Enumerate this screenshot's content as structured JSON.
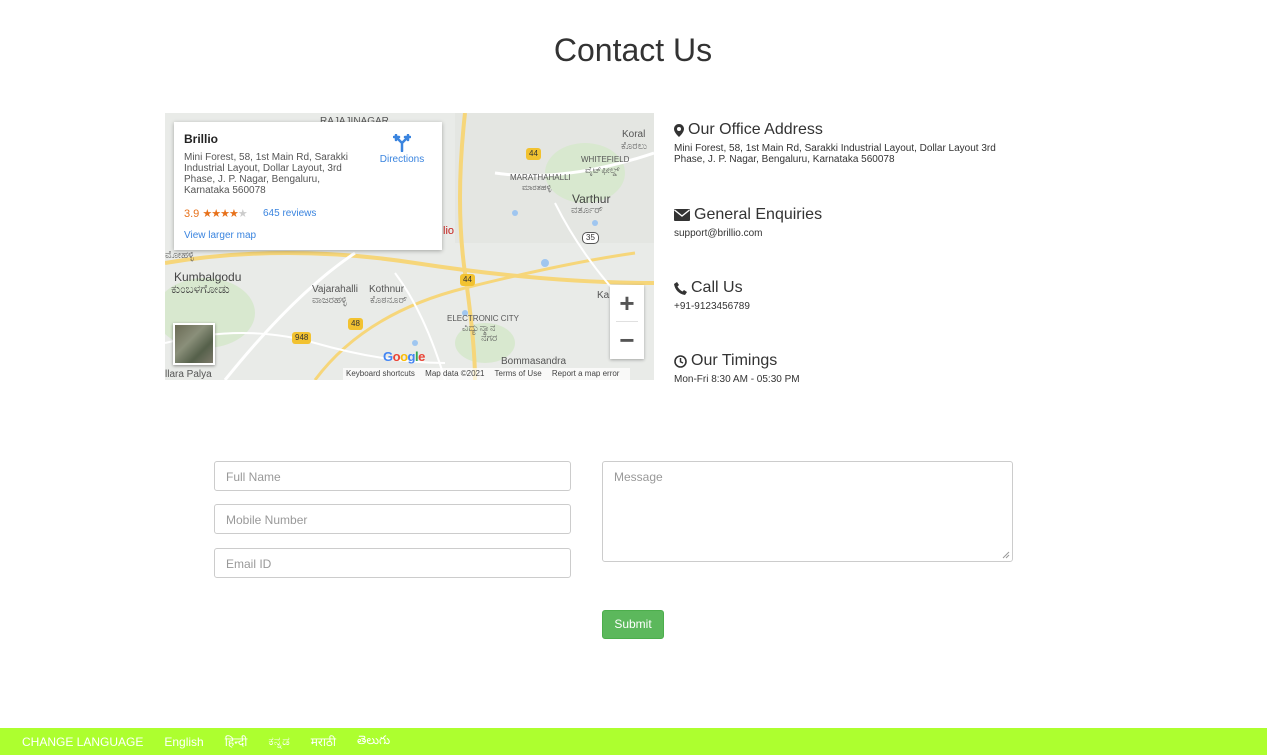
{
  "page": {
    "title": "Contact Us"
  },
  "map": {
    "place_name": "Brillio",
    "place_address": "Mini Forest, 58, 1st Main Rd, Sarakki Industrial Layout, Dollar Layout, 3rd Phase, J. P. Nagar, Bengaluru, Karnataka 560078",
    "rating": "3.9",
    "stars": 3.9,
    "reviews": "645 reviews",
    "directions": "Directions",
    "larger_map": "View larger map",
    "zoom_in": "+",
    "zoom_out": "−",
    "google": "Google",
    "keyboard_shortcuts": "Keyboard shortcuts",
    "map_data": "Map data ©2021",
    "terms": "Terms of Use",
    "report": "Report a map error",
    "labels": {
      "rajajinagar": "RAJAJINAGAR",
      "koral": "Koral",
      "koral_kn": "ಕೊರಲು",
      "whitefield": "WHITEFIELD",
      "whitefield_kn": "ವೈಟ್‌ಫೀಲ್ಡ್",
      "marathahalli": "MARATHAHALLI",
      "marathahalli_kn": "ಮಾರತಹಳ್ಳಿ",
      "varthur": "Varthur",
      "varthur_kn": "ವರ್ತೂರ್",
      "kumbalgodu": "Kumbalgodu",
      "kumbalgodu_kn": "ಕುಂಬಳಗೋಡು",
      "vajarahalli": "Vajarahalli",
      "vajarahalli_kn": "ವಾಜರಹಳ್ಳಿ",
      "kothnur": "Kothnur",
      "kothnur_kn": "ಕೊಠನೂರ್",
      "electronic_city": "ELECTRONIC CITY",
      "electronic_city_kn1": "ವಿದ್ಯುನ್ಮಾನ",
      "electronic_city_kn2": "ನಗರ",
      "bommasandra": "Bommasandra",
      "pallya": "llara Palya",
      "ka": "Ka",
      "lio": "lio",
      "halli_kn": "ಮೋಹಳ್ಳಿ",
      "r44a": "44",
      "r44b": "44",
      "r48": "48",
      "r948": "948",
      "r35": "35"
    }
  },
  "contact": {
    "address_heading": "Our Office Address",
    "address_text": "Mini Forest, 58, 1st Main Rd, Sarakki Industrial Layout, Dollar Layout 3rd Phase, J. P. Nagar, Bengaluru, Karnataka 560078",
    "enquiries_heading": "General Enquiries",
    "enquiries_text": "support@brillio.com",
    "call_heading": "Call Us",
    "call_text": "+91-9123456789",
    "timings_heading": "Our Timings",
    "timings_text": "Mon-Fri 8:30 AM - 05:30 PM"
  },
  "form": {
    "full_name_placeholder": "Full Name",
    "mobile_placeholder": "Mobile Number",
    "email_placeholder": "Email ID",
    "message_placeholder": "Message",
    "submit_label": "Submit"
  },
  "footer": {
    "change_language": "CHANGE LANGUAGE",
    "languages": [
      "English",
      "हिन्दी",
      "ಕನ್ನಡ",
      "मराठी",
      "తెలుగు"
    ]
  }
}
